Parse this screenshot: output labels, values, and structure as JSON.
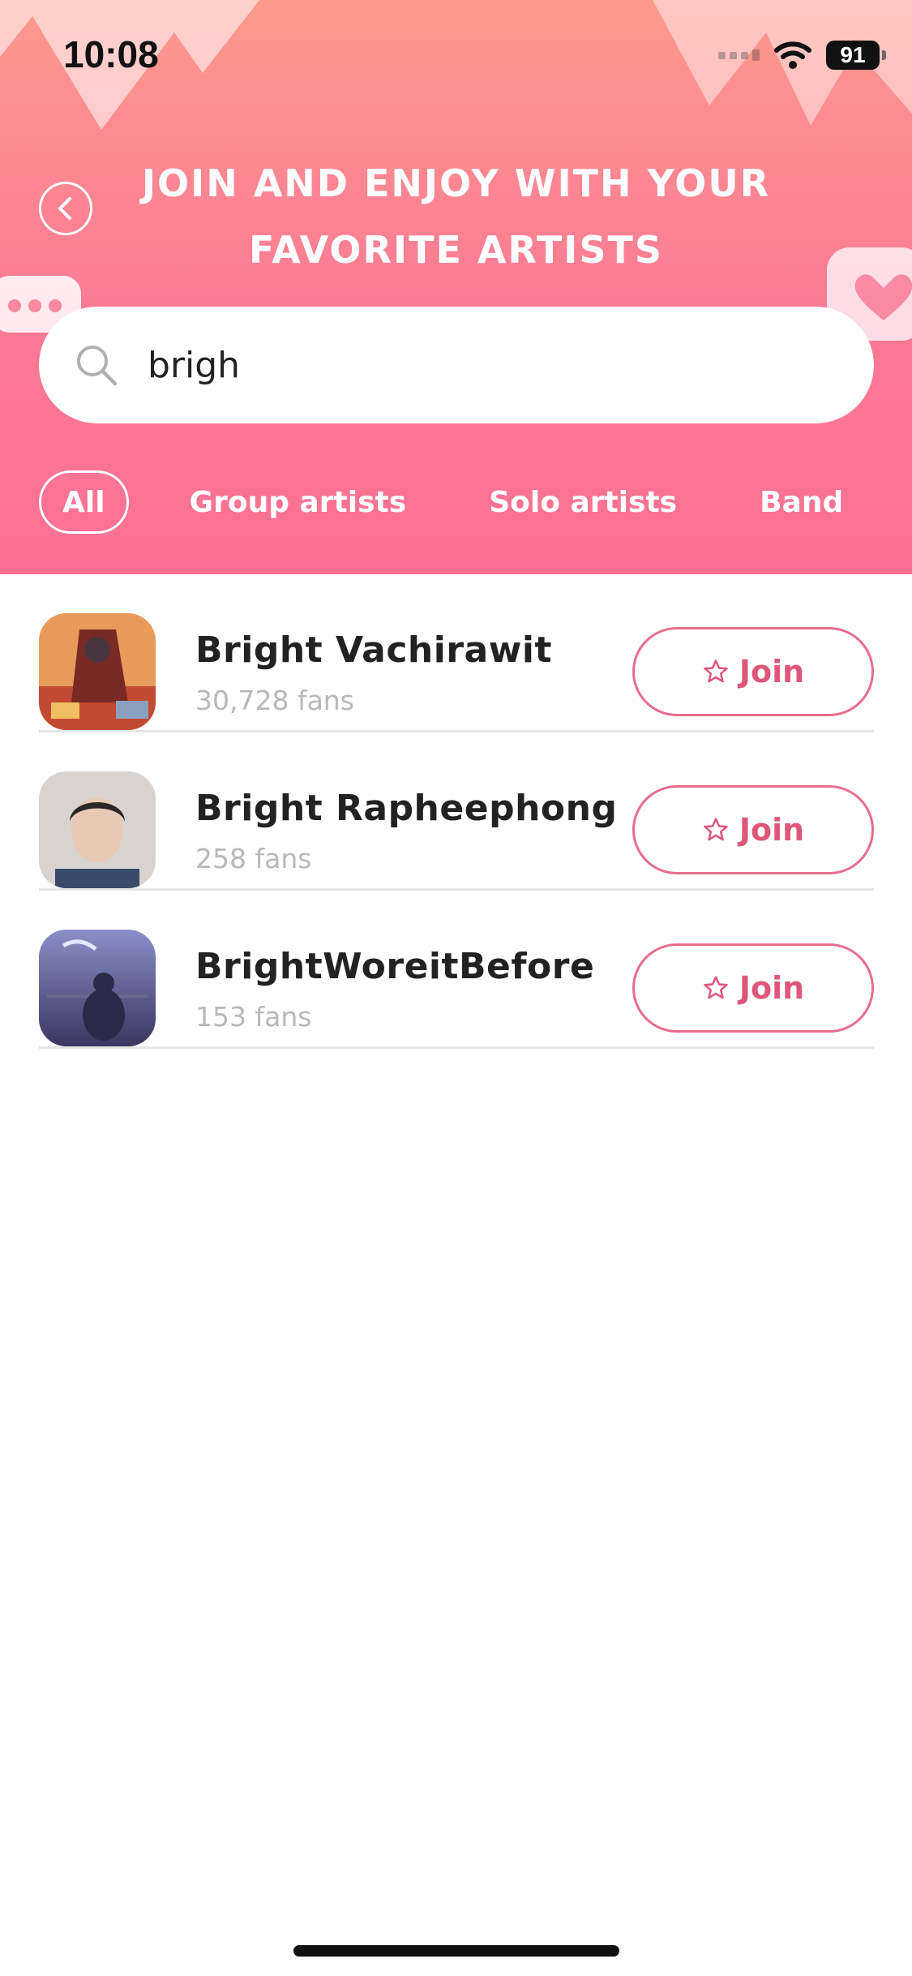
{
  "status_bar": {
    "time": "10:08",
    "battery": "91"
  },
  "header": {
    "title_line1": "JOIN AND ENJOY WITH YOUR",
    "title_line2": "FAVORITE ARTISTS",
    "accent_color": "#fb7a94"
  },
  "search": {
    "value": "brigh",
    "icon": "search-icon"
  },
  "filters": {
    "all": "All",
    "group": "Group artists",
    "solo": "Solo artists",
    "band": "Band"
  },
  "results": [
    {
      "name": "Bright Vachirawit",
      "fans": "30,728 fans",
      "join_label": "Join"
    },
    {
      "name": "Bright Rapheephong",
      "fans": "258 fans",
      "join_label": "Join"
    },
    {
      "name": "BrightWoreitBefore",
      "fans": "153 fans",
      "join_label": "Join"
    }
  ],
  "colors": {
    "join_border": "#e86d8d",
    "join_text": "#e0567b"
  }
}
